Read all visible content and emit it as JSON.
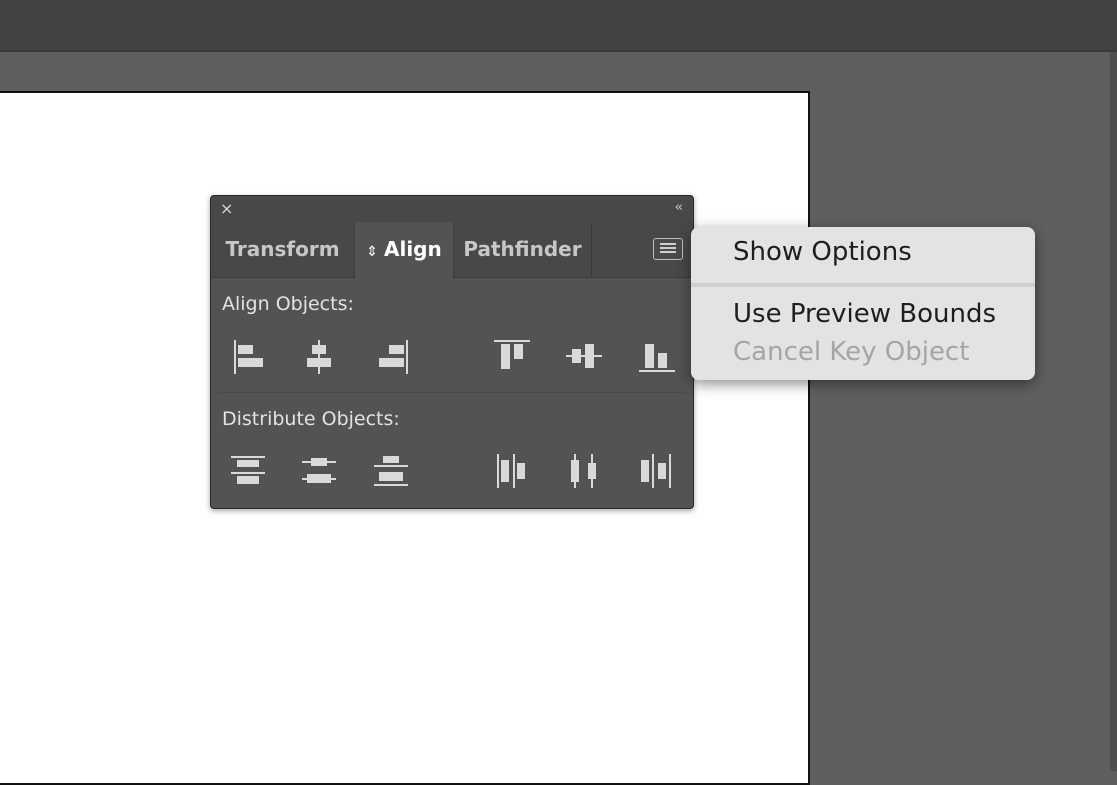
{
  "panel": {
    "close_icon": "×",
    "collapse_icon": "‹‹",
    "tabs": [
      {
        "label": "Transform",
        "active": false
      },
      {
        "label": "Align",
        "active": true,
        "icon": "⇕"
      },
      {
        "label": "Pathfinder",
        "active": false
      }
    ],
    "align_label": "Align Objects:",
    "distribute_label": "Distribute Objects:",
    "align_icons": [
      "align-left-icon",
      "align-horizontal-center-icon",
      "align-right-icon",
      "align-top-icon",
      "align-vertical-center-icon",
      "align-bottom-icon"
    ],
    "distribute_icons": [
      "distribute-top-icon",
      "distribute-vertical-center-icon",
      "distribute-bottom-icon",
      "distribute-left-icon",
      "distribute-horizontal-center-icon",
      "distribute-right-icon"
    ]
  },
  "flyout": {
    "items": [
      {
        "label": "Show Options",
        "enabled": true
      },
      {
        "label": "Use Preview Bounds",
        "enabled": true
      },
      {
        "label": "Cancel Key Object",
        "enabled": false
      }
    ]
  },
  "colors": {
    "panel_bg": "#535353",
    "icon": "#d9d9d9",
    "menu_bg": "#e3e3e3"
  }
}
